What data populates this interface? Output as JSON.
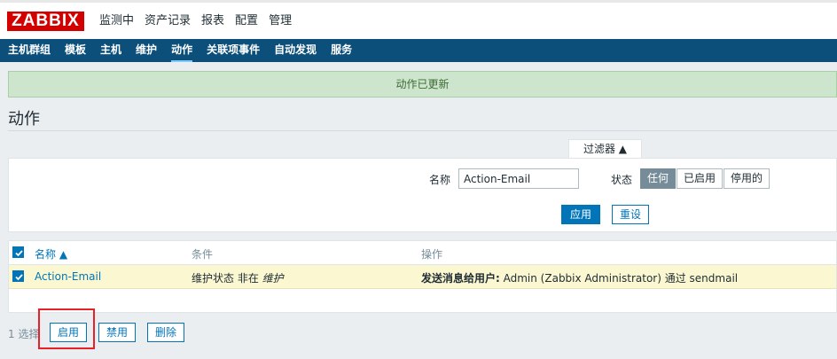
{
  "header": {
    "logo": "ZABBIX",
    "menu": [
      "监测中",
      "资产记录",
      "报表",
      "配置",
      "管理"
    ],
    "active_menu": "配置"
  },
  "subnav": {
    "items": [
      "主机群组",
      "模板",
      "主机",
      "维护",
      "动作",
      "关联项事件",
      "自动发现",
      "服务"
    ],
    "active": "动作"
  },
  "message": "动作已更新",
  "page_title": "动作",
  "filter": {
    "tab_label": "过滤器 ▲",
    "name_label": "名称",
    "name_value": "Action-Email",
    "status_label": "状态",
    "status_options": [
      "任何",
      "已启用",
      "停用的"
    ],
    "status_selected": "任何",
    "apply": "应用",
    "reset": "重设"
  },
  "table": {
    "headers": {
      "name": "名称 ▲",
      "conditions": "条件",
      "operations": "操作"
    },
    "rows": [
      {
        "name": "Action-Email",
        "condition_prefix": "维护状态 非在 ",
        "condition_value": "维护",
        "operation_bold": "发送消息给用户:",
        "operation_text": " Admin (Zabbix Administrator) 通过 sendmail",
        "checked": true
      }
    ]
  },
  "footer": {
    "selected_count": "1 选择",
    "enable": "启用",
    "disable": "禁用",
    "delete": "删除"
  },
  "colors": {
    "accent": "#0275b8",
    "nav_bg": "#0b4f7a",
    "logo_bg": "#d40000",
    "success_bg": "#cde5cc",
    "highlight_row": "#fbf7d1",
    "annotation": "#e8202a"
  }
}
